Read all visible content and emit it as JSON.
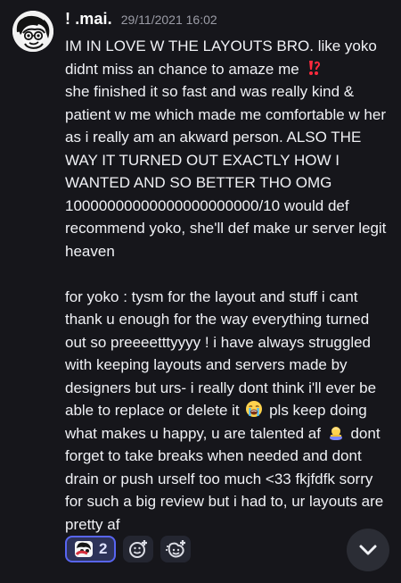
{
  "message": {
    "author": "! .mai.",
    "timestamp": "29/11/2021 16:02",
    "paragraph_1": {
      "text_a": "IM IN LOVE W THE LAYOUTS BRO. like yoko didnt miss an chance to amaze me",
      "text_b": "she finished it so fast and was really kind & patient w me which made me comfortable w her as i really am an akward person. ALSO THE WAY IT TURNED OUT EXACTLY HOW I WANTED AND SO BETTER THO OMG 10000000000000000000000/10 would def recommend yoko, she'll def make ur server legit heaven"
    },
    "paragraph_2": {
      "text_a": "for yoko : tysm for the layout and stuff i cant thank u enough for the way everything turned out so preeeetttyyyy ! i have always struggled with keeping layouts and servers made by designers but urs- i really dont think i'll ever be able to replace or delete it",
      "text_b": "pls keep doing what makes u happy, u are talented af",
      "text_c": "dont forget to take breaks when needed and dont drain or push urself too much <33 fkjfdfk sorry for such a big review but i had to, ur layouts are pretty af"
    }
  },
  "emojis": {
    "interrobang": "exclamation-question-mark-emoji",
    "crying": "loudly-crying-face-emoji",
    "bowing": "person-bowing-emoji"
  },
  "reactions": {
    "custom_reaction_count": "2",
    "icons": [
      "custom-character-emoji-icon",
      "add-reaction-icon",
      "add-super-reaction-icon"
    ]
  },
  "colors": {
    "background": "#16161b",
    "reaction_selected_border": "#5865f2",
    "reaction_selected_background": "#2d3258",
    "reaction_background": "#242631",
    "timestamp": "#9b9ca6",
    "interrobang": "#ff2a3d"
  },
  "controls": {
    "scroll_icon": "chevron-down-icon"
  }
}
